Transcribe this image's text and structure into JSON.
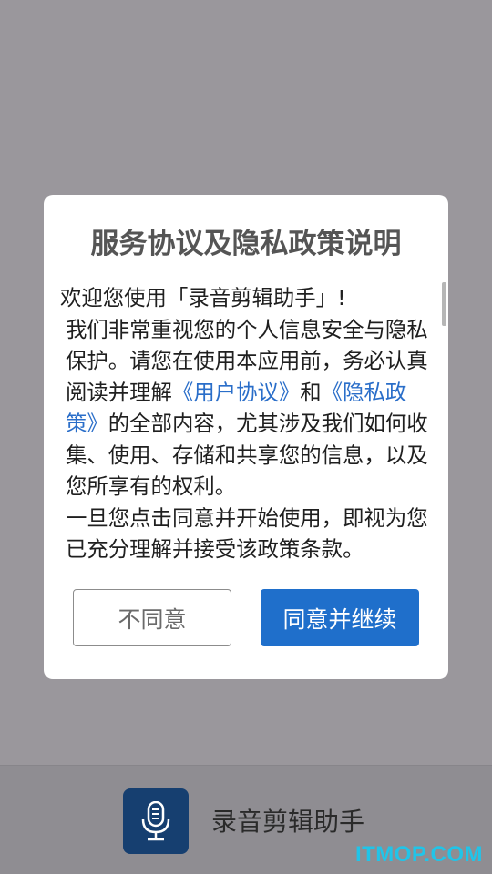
{
  "background_app": {
    "name": "录音剪辑助手",
    "icon": "microphone-icon"
  },
  "dialog": {
    "title": "服务协议及隐私政策说明",
    "greeting": "欢迎您使用「录音剪辑助手」!",
    "para1_before": "我们非常重视您的个人信息安全与隐私保护。请您在使用本应用前，务必认真阅读并理解",
    "user_agreement_link": "《用户协议》",
    "and_text": "和",
    "privacy_policy_link": "《隐私政策》",
    "para1_after": "的全部内容，尤其涉及我们如何收集、使用、存储和共享您的信息，以及您所享有的权利。",
    "para2": "一旦您点击同意并开始使用，即视为您已充分理解并接受该政策条款。",
    "disagree_label": "不同意",
    "agree_label": "同意并继续"
  },
  "watermark": "ITMOP.COM",
  "colors": {
    "overlay": "#9a979c",
    "link": "#2a6ec9",
    "primary_button": "#1f6fcb",
    "app_icon_bg": "#163f70",
    "watermark": "#21c4e8"
  }
}
